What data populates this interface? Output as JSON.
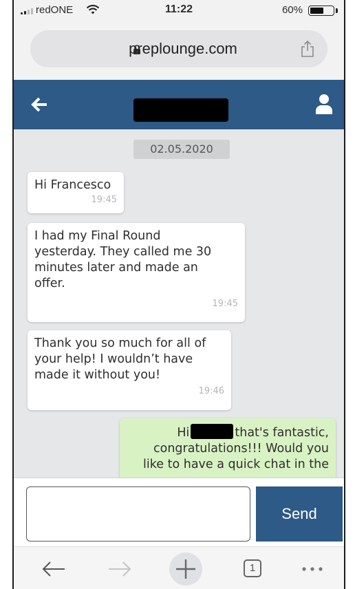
{
  "status_bar": {
    "carrier": "redONE",
    "time": "11:22",
    "battery_percent_label": "60%",
    "battery_level": 0.6
  },
  "browser": {
    "url": "preplounge.com"
  },
  "header": {
    "title_redacted": true
  },
  "chat": {
    "date": "02.05.2020",
    "messages": [
      {
        "lines": [
          "Hi Francesco"
        ],
        "time": "19:45"
      },
      {
        "lines": [
          "I had my Final Round",
          "yesterday. They called me 30",
          "minutes later and made an",
          "offer."
        ],
        "time": "19:45"
      },
      {
        "lines": [
          "Thank you so much for all of",
          "your help! I wouldn’t have",
          "made it without you!"
        ],
        "time": "19:46"
      },
      {
        "prefix": "Hi",
        "suffix": "that's fantastic,",
        "line2": "congratulations!!! Would you",
        "line3": "like to have a quick chat in the"
      }
    ]
  },
  "composer": {
    "input_value": "",
    "send_label": "Send"
  },
  "toolbar": {
    "tabs_count": "1"
  },
  "colors": {
    "header_blue": "#2d5a86",
    "outgoing_bubble": "#d9f2c4",
    "chat_background": "#e6e7e9"
  }
}
